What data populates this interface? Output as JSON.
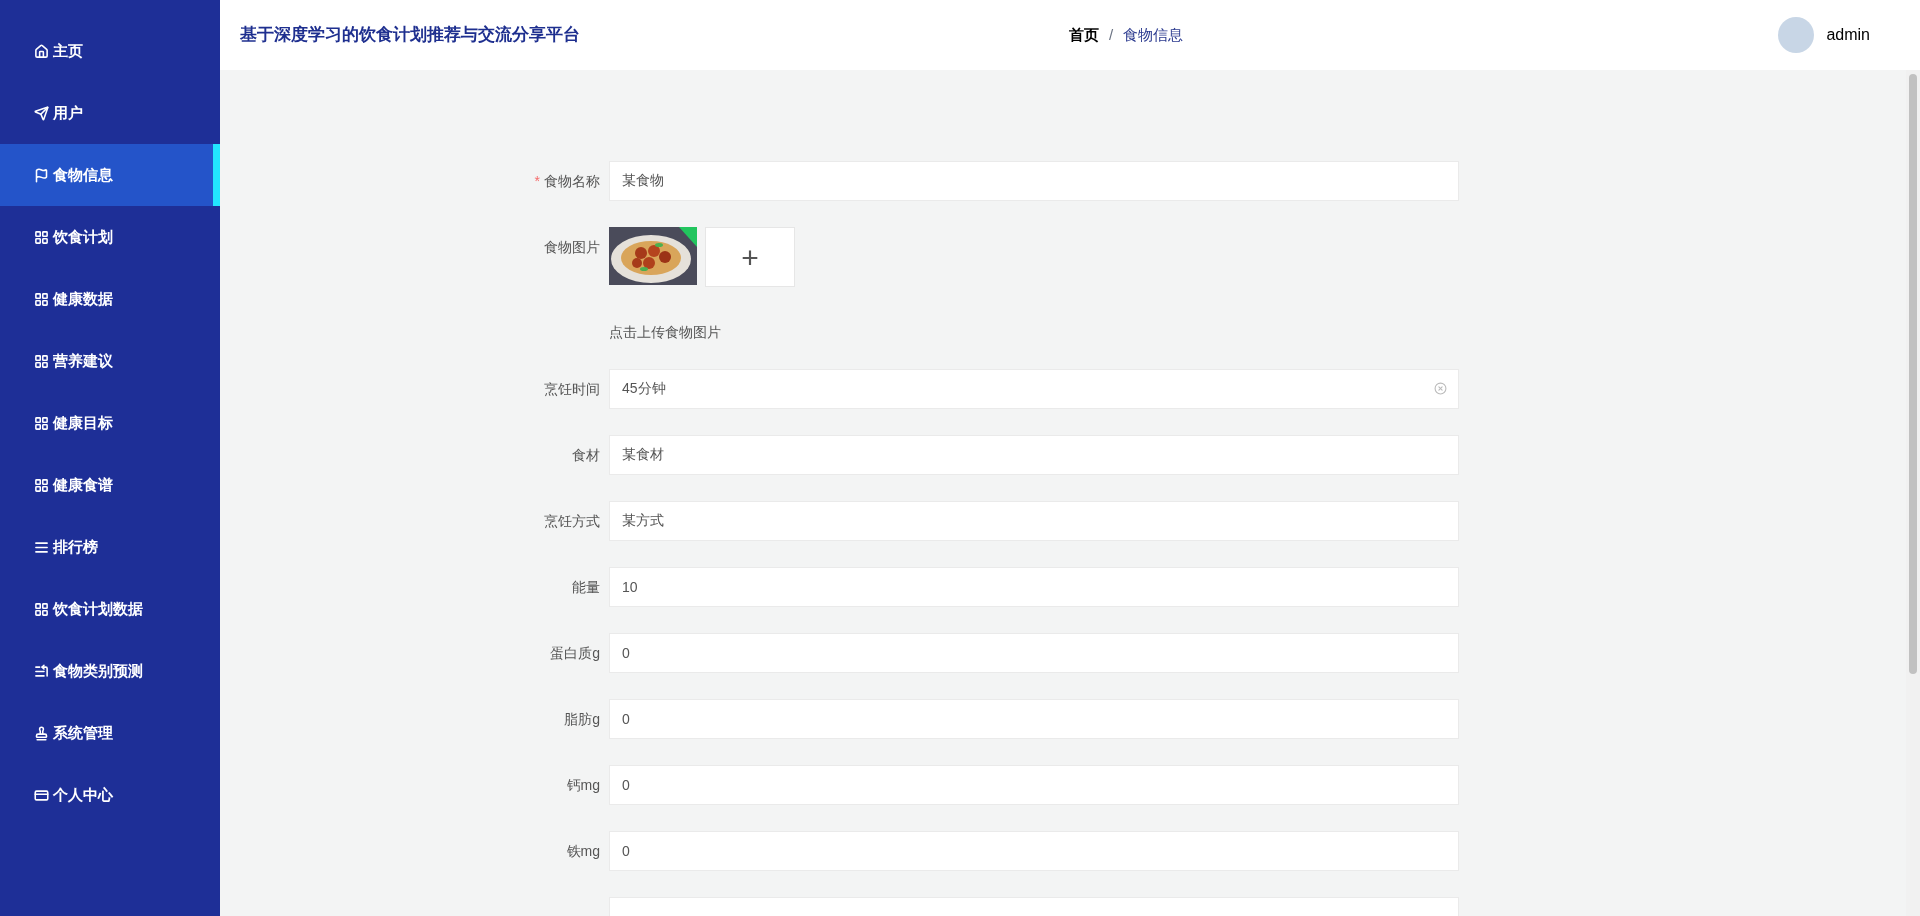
{
  "sidebar": {
    "items": [
      {
        "label": "主页",
        "selected": false
      },
      {
        "label": "用户",
        "selected": false
      },
      {
        "label": "食物信息",
        "selected": true
      },
      {
        "label": "饮食计划",
        "selected": false
      },
      {
        "label": "健康数据",
        "selected": false
      },
      {
        "label": "营养建议",
        "selected": false
      },
      {
        "label": "健康目标",
        "selected": false
      },
      {
        "label": "健康食谱",
        "selected": false
      },
      {
        "label": "排行榜",
        "selected": false
      },
      {
        "label": "饮食计划数据",
        "selected": false
      },
      {
        "label": "食物类别预测",
        "selected": false
      },
      {
        "label": "系统管理",
        "selected": false
      },
      {
        "label": "个人中心",
        "selected": false
      }
    ]
  },
  "header": {
    "title": "基于深度学习的饮食计划推荐与交流分享平台",
    "breadcrumb": [
      "首页",
      "食物信息"
    ],
    "separator": "/",
    "user": "admin"
  },
  "form": {
    "fields": [
      {
        "kind": "text",
        "label": "食物名称",
        "required_mark": "*",
        "value": "某食物",
        "clearable": false
      },
      {
        "label": "食物图片",
        "upload_icon": "+",
        "hint": "点击上传食物图片"
      },
      {
        "kind": "text",
        "label": "烹饪时间",
        "value": "45分钟",
        "clearable": true
      },
      {
        "kind": "text",
        "label": "食材",
        "value": "某食材",
        "clearable": false
      },
      {
        "kind": "text",
        "label": "烹饪方式",
        "value": "某方式",
        "clearable": false
      },
      {
        "kind": "text",
        "label": "能量",
        "value": "10",
        "clearable": false
      },
      {
        "kind": "text",
        "label": "蛋白质g",
        "value": "0",
        "clearable": false
      },
      {
        "kind": "text",
        "label": "脂肪g",
        "value": "0",
        "clearable": false
      },
      {
        "kind": "text",
        "label": "钙mg",
        "value": "0",
        "clearable": false
      },
      {
        "kind": "text",
        "label": "铁mg",
        "value": "0",
        "clearable": false
      }
    ]
  }
}
